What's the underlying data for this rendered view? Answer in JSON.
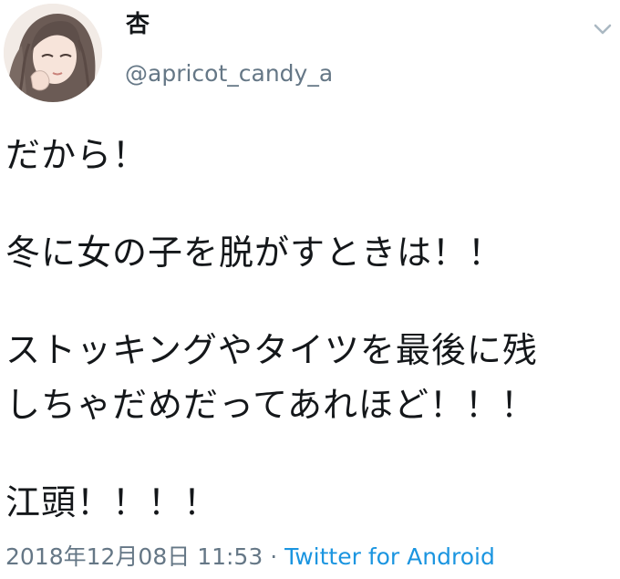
{
  "user": {
    "display_name": "杏",
    "handle": "@apricot_candy_a"
  },
  "tweet": {
    "lines": [
      "だから！",
      "",
      "冬に女の子を脱がすときは！！",
      "",
      "ストッキングやタイツを最後に残",
      "しちゃだめだってあれほど！！！",
      "",
      "江頭！！！！"
    ]
  },
  "footer": {
    "timestamp": "2018年12月08日 11:53",
    "separator": " · ",
    "source": "Twitter for Android"
  },
  "colors": {
    "text": "#14171a",
    "secondary": "#657786",
    "link": "#1b95e0"
  },
  "icons": {
    "menu": "chevron-down-icon"
  }
}
